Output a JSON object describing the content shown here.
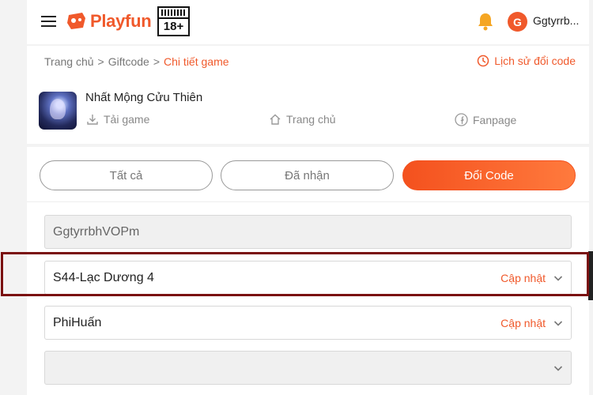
{
  "header": {
    "logo_text": "Playfun",
    "age_label": "18+",
    "avatar_initial": "G",
    "user_name": "Ggtyrrb..."
  },
  "breadcrumb": {
    "home": "Trang chủ",
    "sep1": ">",
    "giftcode": "Giftcode",
    "sep2": ">",
    "current": "Chi tiết game"
  },
  "history_label": "Lịch sử đổi code",
  "game": {
    "title": "Nhất Mộng Cửu Thiên",
    "download_label": "Tải game",
    "home_label": "Trang chủ",
    "fanpage_label": "Fanpage"
  },
  "tabs": [
    {
      "label": "Tất cả",
      "active": false
    },
    {
      "label": "Đã nhận",
      "active": false
    },
    {
      "label": "Đổi Code",
      "active": true
    }
  ],
  "form": {
    "account": "GgtyrrbhVOPm",
    "server": {
      "value": "S44-Lạc Dương 4",
      "update_label": "Cập nhật"
    },
    "character": {
      "value": "PhiHuấn",
      "update_label": "Cập nhật"
    },
    "empty_select": {
      "value": ""
    }
  },
  "colors": {
    "accent": "#f0592b",
    "highlight": "#7a1010"
  },
  "icons": [
    "menu-icon",
    "gamepad-logo-icon",
    "bell-icon",
    "history-icon",
    "download-icon",
    "home-icon",
    "facebook-icon",
    "chevron-down-icon"
  ]
}
